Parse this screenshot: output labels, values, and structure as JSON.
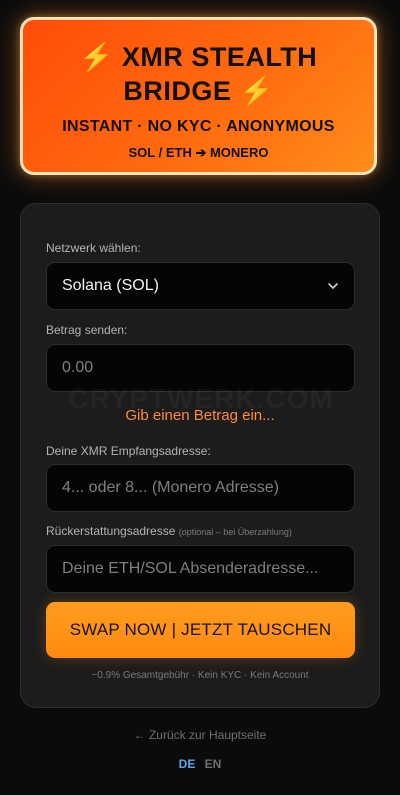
{
  "hero": {
    "bolt": "⚡",
    "title_line1": "XMR STEALTH",
    "title_line2": "BRIDGE",
    "tagline": "INSTANT · NO KYC · ANONYMOUS",
    "route": "SOL / ETH ➔ MONERO"
  },
  "form": {
    "network_label": "Netzwerk wählen:",
    "network_selected": "Solana (SOL)",
    "amount_label": "Betrag senden:",
    "amount_placeholder": "0.00",
    "watermark": "CRYPTWERK.COM",
    "amount_hint": "Gib einen Betrag ein...",
    "xmr_label": "Deine XMR Empfangsadresse:",
    "xmr_placeholder": "4... oder 8... (Monero Adresse)",
    "refund_label": "Rückerstattungsadresse",
    "refund_note": "(optional – bei Überzahlung)",
    "refund_placeholder": "Deine ETH/SOL Absenderadresse...",
    "swap_button": "SWAP NOW | JETZT TAUSCHEN",
    "fee_info": "~0.9% Gesamtgebühr · Kein KYC · Kein Account"
  },
  "footer": {
    "back_link": "← Zurück zur Hauptseite",
    "lang_de": "DE",
    "lang_en": "EN",
    "active_lang": "DE"
  },
  "colors": {
    "accent": "#ff8a10",
    "hint": "#ff8a3a",
    "active_lang": "#5aa7e6"
  }
}
